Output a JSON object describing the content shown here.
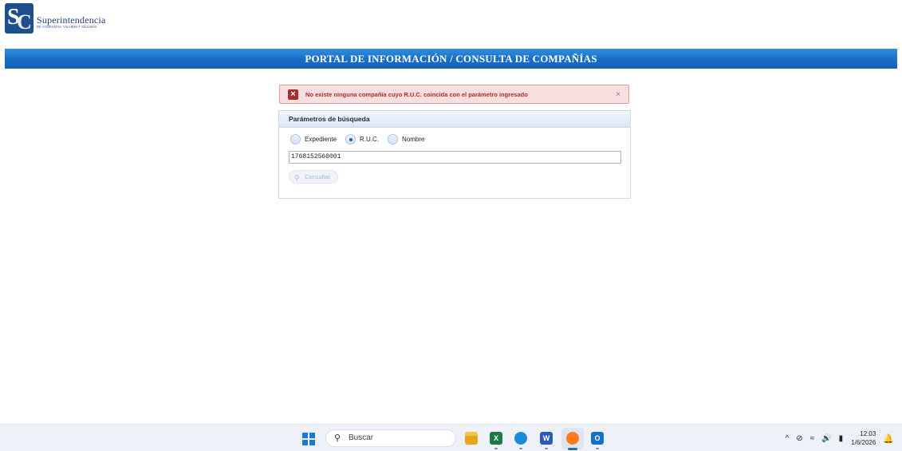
{
  "logo": {
    "title": "Superintendencia",
    "subtitle": "DE COMPAÑÍAS, VALORES Y SEGUROS"
  },
  "header": {
    "title": "PORTAL DE INFORMACIÓN / CONSULTA DE COMPAÑÍAS"
  },
  "alert": {
    "message": "No existe ninguna compañía cuyo R.U.C. coincida con el parámetro ingresado",
    "close": "×"
  },
  "panel": {
    "title": "Parámetros de búsqueda",
    "radios": [
      {
        "label": "Expediente",
        "checked": false
      },
      {
        "label": "R.U.C.",
        "checked": true
      },
      {
        "label": "Nombre",
        "checked": false
      }
    ],
    "input_value": "1768152560001",
    "button_label": "Consultar"
  },
  "taskbar": {
    "search_placeholder": "Buscar",
    "excel_letter": "X",
    "word_letter": "W",
    "outlook_letter": "O",
    "time": "12:03",
    "date": "1/6/2026"
  },
  "colors": {
    "accent": "#1a6fc8",
    "error": "#b02a2a"
  }
}
